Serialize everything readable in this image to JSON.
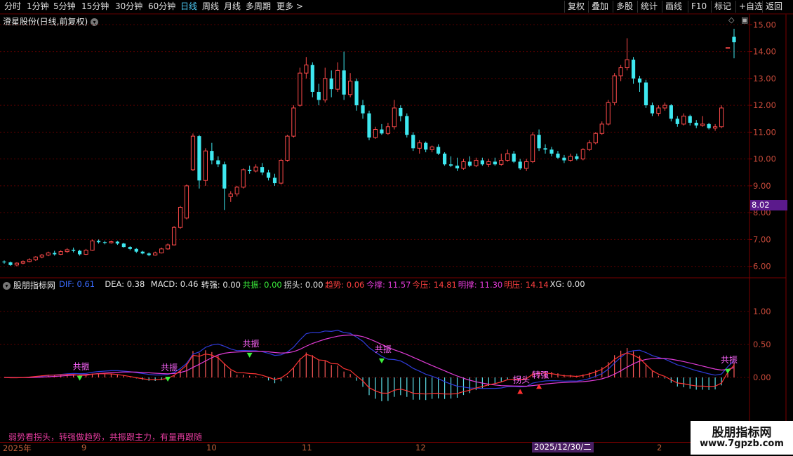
{
  "toolbar": {
    "periods": [
      "分时",
      "1分钟",
      "5分钟",
      "15分钟",
      "30分钟",
      "60分钟",
      "日线",
      "周线",
      "月线",
      "多周期",
      "更多"
    ],
    "active_period": "日线",
    "right_buttons": [
      "复权",
      "叠加",
      "多股",
      "统计",
      "画线",
      "F10",
      "标记",
      "+自选",
      "返回"
    ]
  },
  "main_chart": {
    "title": "澄星股份(日线,前复权)",
    "price_ticks": [
      "15.00",
      "14.00",
      "13.00",
      "12.00",
      "11.00",
      "10.00",
      "9.00",
      "8.00",
      "7.00",
      "6.00"
    ],
    "current_price_tag": "8.02"
  },
  "indicator": {
    "name": "股朋指标网",
    "values": [
      {
        "label": "DIF: 0.61",
        "color": "#3a6cff"
      },
      {
        "label": "DEA: 0.38",
        "color": "#e8e8e8"
      },
      {
        "label": "MACD: 0.46",
        "color": "#e8e8e8"
      },
      {
        "label": "转强: 0.00",
        "color": "#e8e8e8"
      },
      {
        "label": "共振: 0.00",
        "color": "#3cf03c"
      },
      {
        "label": "拐头: 0.00",
        "color": "#e8e8e8"
      },
      {
        "label": "趋势: 0.06",
        "color": "#ff4040"
      },
      {
        "label": "今撑: 11.57",
        "color": "#e03bd6"
      },
      {
        "label": "今压: 14.81",
        "color": "#ff4040"
      },
      {
        "label": "明撑: 11.30",
        "color": "#e03bd6"
      },
      {
        "label": "明压: 14.14",
        "color": "#ff4040"
      },
      {
        "label": "XG: 0.00",
        "color": "#e8e8e8"
      }
    ],
    "ticks": [
      "1.00",
      "0.50",
      "0.00"
    ],
    "annotations": {
      "resonance": "共振",
      "strengthen": "转强",
      "turn": "拐头"
    }
  },
  "slogan": "弱势看拐头，转强做趋势，共振跟主力，有量再跟随",
  "dates": [
    "2025年",
    "9",
    "10",
    "11",
    "12",
    "2"
  ],
  "highlight_date": "2025/12/30/二",
  "watermark": {
    "title": "股朋指标网",
    "url": "www.7gpzb.com"
  },
  "colors": {
    "up": "#ff4a4a",
    "down": "#3ee8f0",
    "dif": "#2f3bd9",
    "dea": "#e03bd6",
    "trend": "#ff3333"
  },
  "chart_data": {
    "type": "candlestick",
    "y_range": [
      5.6,
      15.4
    ],
    "candles": [
      [
        6.18,
        6.15,
        6.22,
        6.1
      ],
      [
        6.15,
        6.05,
        6.18,
        6.02
      ],
      [
        6.05,
        6.12,
        6.15,
        6.0
      ],
      [
        6.12,
        6.18,
        6.22,
        6.08
      ],
      [
        6.18,
        6.25,
        6.3,
        6.15
      ],
      [
        6.25,
        6.35,
        6.38,
        6.2
      ],
      [
        6.35,
        6.42,
        6.46,
        6.3
      ],
      [
        6.42,
        6.5,
        6.55,
        6.38
      ],
      [
        6.5,
        6.45,
        6.58,
        6.4
      ],
      [
        6.45,
        6.55,
        6.6,
        6.42
      ],
      [
        6.55,
        6.62,
        6.68,
        6.5
      ],
      [
        6.62,
        6.58,
        6.7,
        6.52
      ],
      [
        6.58,
        6.45,
        6.62,
        6.4
      ],
      [
        6.45,
        6.6,
        6.65,
        6.42
      ],
      [
        6.6,
        6.95,
        7.0,
        6.58
      ],
      [
        6.95,
        6.9,
        7.0,
        6.85
      ],
      [
        6.9,
        6.88,
        6.95,
        6.82
      ],
      [
        6.88,
        6.92,
        6.96,
        6.85
      ],
      [
        6.92,
        6.85,
        6.95,
        6.8
      ],
      [
        6.85,
        6.72,
        6.88,
        6.7
      ],
      [
        6.72,
        6.65,
        6.75,
        6.6
      ],
      [
        6.65,
        6.55,
        6.68,
        6.5
      ],
      [
        6.55,
        6.48,
        6.58,
        6.45
      ],
      [
        6.48,
        6.42,
        6.52,
        6.38
      ],
      [
        6.42,
        6.5,
        6.55,
        6.4
      ],
      [
        6.5,
        6.65,
        6.7,
        6.48
      ],
      [
        6.65,
        6.8,
        6.85,
        6.62
      ],
      [
        6.8,
        7.45,
        7.5,
        6.78
      ],
      [
        7.45,
        8.2,
        8.25,
        7.4
      ],
      [
        7.8,
        9.0,
        9.05,
        7.75
      ],
      [
        9.6,
        10.85,
        10.95,
        9.55
      ],
      [
        10.85,
        9.2,
        10.9,
        8.9
      ],
      [
        9.2,
        10.3,
        10.4,
        9.0
      ],
      [
        10.3,
        9.95,
        10.6,
        9.8
      ],
      [
        9.95,
        9.8,
        10.1,
        9.7
      ],
      [
        9.8,
        8.9,
        9.9,
        8.1
      ],
      [
        8.6,
        8.7,
        8.8,
        8.4
      ],
      [
        8.7,
        8.95,
        9.0,
        8.6
      ],
      [
        8.95,
        9.6,
        9.65,
        8.9
      ],
      [
        9.6,
        9.55,
        9.75,
        9.45
      ],
      [
        9.55,
        9.7,
        9.8,
        9.5
      ],
      [
        9.7,
        9.5,
        9.85,
        9.4
      ],
      [
        9.5,
        9.3,
        9.6,
        9.2
      ],
      [
        9.3,
        9.1,
        9.45,
        9.0
      ],
      [
        9.1,
        9.95,
        10.0,
        9.05
      ],
      [
        9.95,
        10.85,
        10.9,
        9.9
      ],
      [
        10.85,
        11.9,
        12.0,
        10.8
      ],
      [
        12.0,
        13.2,
        13.4,
        11.95
      ],
      [
        13.2,
        13.5,
        13.8,
        13.0
      ],
      [
        13.5,
        12.5,
        13.6,
        12.3
      ],
      [
        12.5,
        12.2,
        12.8,
        12.0
      ],
      [
        12.2,
        13.0,
        13.4,
        12.1
      ],
      [
        13.0,
        12.6,
        13.3,
        12.3
      ],
      [
        12.6,
        13.3,
        13.6,
        12.5
      ],
      [
        13.3,
        12.4,
        14.0,
        12.2
      ],
      [
        12.4,
        12.9,
        13.2,
        12.3
      ],
      [
        12.9,
        12.0,
        13.0,
        11.8
      ],
      [
        12.0,
        11.7,
        12.2,
        11.5
      ],
      [
        11.7,
        10.8,
        11.8,
        10.7
      ],
      [
        10.8,
        11.1,
        11.2,
        10.75
      ],
      [
        11.1,
        10.95,
        11.3,
        10.9
      ],
      [
        10.95,
        11.2,
        11.35,
        10.9
      ],
      [
        11.2,
        11.9,
        12.2,
        11.1
      ],
      [
        11.9,
        11.6,
        12.0,
        11.4
      ],
      [
        11.6,
        10.9,
        11.7,
        10.8
      ],
      [
        10.9,
        10.4,
        11.0,
        10.3
      ],
      [
        10.4,
        10.6,
        10.7,
        10.2
      ],
      [
        10.6,
        10.35,
        10.65,
        10.25
      ],
      [
        10.35,
        10.45,
        10.5,
        10.25
      ],
      [
        10.45,
        10.2,
        10.55,
        10.15
      ],
      [
        10.2,
        9.8,
        10.25,
        9.75
      ],
      [
        9.8,
        9.75,
        10.1,
        9.7
      ],
      [
        9.75,
        9.65,
        10.05,
        9.55
      ],
      [
        9.65,
        9.9,
        10.0,
        9.6
      ],
      [
        9.9,
        9.75,
        10.1,
        9.7
      ],
      [
        9.75,
        9.95,
        10.05,
        9.7
      ],
      [
        9.95,
        9.8,
        10.05,
        9.75
      ],
      [
        9.8,
        9.9,
        10.0,
        9.7
      ],
      [
        9.9,
        9.8,
        10.05,
        9.75
      ],
      [
        9.8,
        9.95,
        10.2,
        9.75
      ],
      [
        9.95,
        10.2,
        10.35,
        9.9
      ],
      [
        10.2,
        9.9,
        10.3,
        9.85
      ],
      [
        9.9,
        9.65,
        10.0,
        9.6
      ],
      [
        9.65,
        9.9,
        10.0,
        9.55
      ],
      [
        9.9,
        10.9,
        11.0,
        9.85
      ],
      [
        10.9,
        10.4,
        11.1,
        10.3
      ],
      [
        10.4,
        10.35,
        10.55,
        10.2
      ],
      [
        10.35,
        10.2,
        10.45,
        10.1
      ],
      [
        10.2,
        10.05,
        10.3,
        10.0
      ],
      [
        10.05,
        9.95,
        10.15,
        9.85
      ],
      [
        9.95,
        10.1,
        10.2,
        9.9
      ],
      [
        10.1,
        10.0,
        10.2,
        9.95
      ],
      [
        10.0,
        10.35,
        10.4,
        9.95
      ],
      [
        10.35,
        10.6,
        10.7,
        10.3
      ],
      [
        10.6,
        10.95,
        11.0,
        10.55
      ],
      [
        10.95,
        11.3,
        11.4,
        10.9
      ],
      [
        11.3,
        12.1,
        12.2,
        11.25
      ],
      [
        12.1,
        13.1,
        13.2,
        12.0
      ],
      [
        13.1,
        13.4,
        13.5,
        12.9
      ],
      [
        13.4,
        13.7,
        14.5,
        13.3
      ],
      [
        13.7,
        13.0,
        13.8,
        12.8
      ],
      [
        13.0,
        12.85,
        13.1,
        12.5
      ],
      [
        12.85,
        12.0,
        12.95,
        11.9
      ],
      [
        12.0,
        11.7,
        12.1,
        11.6
      ],
      [
        11.7,
        11.9,
        12.0,
        11.6
      ],
      [
        11.9,
        12.0,
        12.1,
        11.8
      ],
      [
        12.0,
        11.5,
        12.05,
        11.4
      ],
      [
        11.5,
        11.3,
        11.6,
        11.2
      ],
      [
        11.3,
        11.6,
        11.7,
        11.25
      ],
      [
        11.6,
        11.35,
        11.65,
        11.25
      ],
      [
        11.35,
        11.25,
        11.45,
        11.15
      ],
      [
        11.25,
        11.3,
        11.6,
        11.2
      ],
      [
        11.3,
        11.15,
        11.35,
        11.1
      ],
      [
        11.15,
        11.2,
        11.3,
        11.05
      ],
      [
        11.2,
        11.9,
        12.0,
        11.15
      ],
      [
        14.15,
        14.15,
        14.15,
        14.15
      ],
      [
        14.55,
        14.35,
        14.85,
        13.75
      ]
    ]
  }
}
